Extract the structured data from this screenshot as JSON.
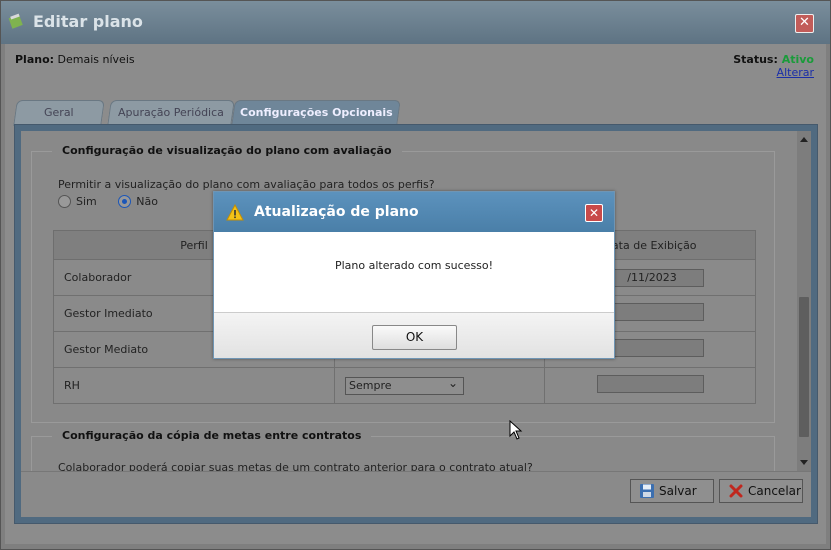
{
  "window": {
    "title": "Editar plano",
    "close_label": "✕"
  },
  "plano": {
    "label": "Plano:",
    "value": "Demais níveis"
  },
  "status": {
    "label": "Status:",
    "value": "Ativo",
    "link": "Alterar",
    "value_color": "#1a9b3a"
  },
  "tabs": [
    {
      "label": "Geral",
      "active": false
    },
    {
      "label": "Apuração Periódica",
      "active": false
    },
    {
      "label": "Configurações Opcionais",
      "active": true
    }
  ],
  "section1": {
    "legend": "Configuração de visualização do plano com avaliação",
    "question": "Permitir a visualização do plano com avaliação para todos os perfis?",
    "options": [
      {
        "label": "Sim",
        "checked": false
      },
      {
        "label": "Não",
        "checked": true
      }
    ],
    "table": {
      "headers": [
        "Perfil",
        "",
        "Data de Exibição"
      ],
      "rows": [
        {
          "perfil": "Colaborador",
          "visibilidade": "",
          "data": "/11/2023"
        },
        {
          "perfil": "Gestor Imediato",
          "visibilidade": "",
          "data": ""
        },
        {
          "perfil": "Gestor Mediato",
          "visibilidade": "",
          "data": ""
        },
        {
          "perfil": "RH",
          "visibilidade": "Sempre",
          "data": ""
        }
      ]
    }
  },
  "section2": {
    "legend": "Configuração da cópia de metas entre contratos",
    "text": "Colaborador poderá copiar suas metas de um contrato anterior para o contrato atual?"
  },
  "buttons": {
    "save": "Salvar",
    "cancel": "Cancelar"
  },
  "modal": {
    "title": "Atualização de plano",
    "message": "Plano alterado com sucesso!",
    "ok": "OK",
    "close_label": "✕"
  }
}
